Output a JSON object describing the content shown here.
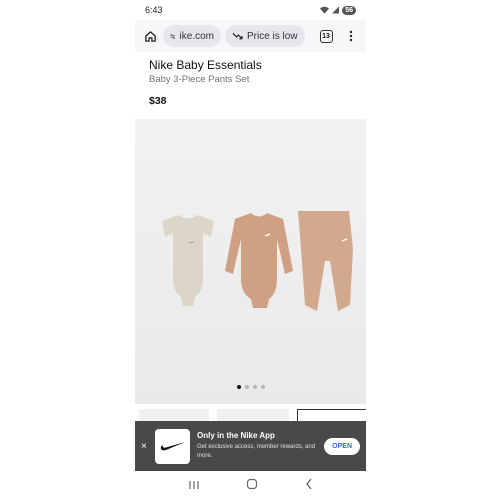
{
  "status": {
    "time": "6:43",
    "battery": "56"
  },
  "browser": {
    "url": "ike.com",
    "price_chip": "Price is low",
    "tab_count": "13"
  },
  "product": {
    "brand": "Nike Baby Essentials",
    "subtitle": "Baby 3-Piece Pants Set",
    "price": "$38",
    "carousel": {
      "count": 4,
      "active_index": 0
    }
  },
  "banner": {
    "close": "×",
    "title": "Only in the Nike App",
    "desc": "Get exclusive access, member rewards, and more.",
    "open": "OPEN"
  },
  "icons": [
    "home-icon",
    "site-settings-icon",
    "trending-down-icon",
    "tab-switcher-icon",
    "more-options-icon",
    "wifi-icon",
    "signal-icon",
    "battery-icon",
    "close-icon",
    "nike-logo-icon",
    "recent-apps-icon",
    "home-nav-icon",
    "back-icon"
  ],
  "colors": {
    "banner_bg": "#494949",
    "open_text": "#2f6bd8",
    "bodysuit_1": "#dcd6c9",
    "bodysuit_2": "#cfa083",
    "pants": "#d2a98d"
  }
}
